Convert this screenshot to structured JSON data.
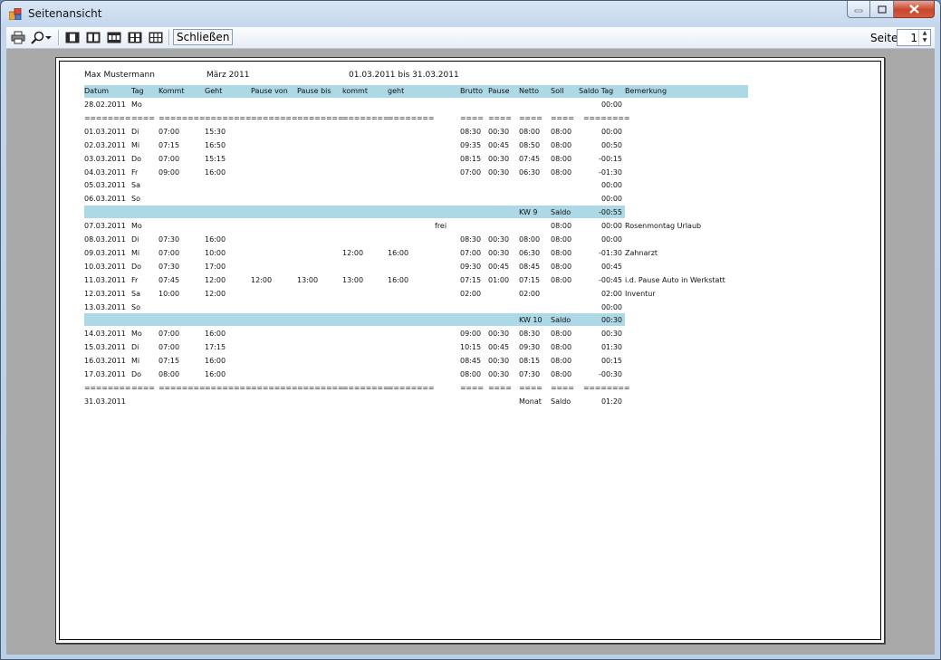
{
  "window": {
    "title": "Seitenansicht"
  },
  "toolbar": {
    "close_label": "Schließen",
    "page_label": "Seite",
    "page_value": "1"
  },
  "report": {
    "name": "Max Mustermann",
    "month": "März 2011",
    "period": "01.03.2011 bis 31.03.2011",
    "headers": [
      "Datum",
      "Tag",
      "Kommt",
      "Geht",
      "Pause von",
      "Pause bis",
      "kommt",
      "geht",
      "Brutto",
      "Pause",
      "Netto",
      "Soll",
      "Saldo Tag",
      "Bemerkung"
    ],
    "rows": [
      {
        "type": "day",
        "cells": [
          "28.02.2011",
          "Mo",
          "",
          "",
          "",
          "",
          "",
          "",
          "",
          "",
          "",
          "",
          "",
          "00:00",
          ""
        ]
      },
      {
        "type": "sep",
        "cells": [
          "========",
          "====",
          "========",
          "========",
          "========",
          "========",
          "========",
          "========",
          "",
          "====",
          "====",
          "====",
          "====",
          "========",
          ""
        ]
      },
      {
        "type": "day",
        "cells": [
          "01.03.2011",
          "Di",
          "07:00",
          "15:30",
          "",
          "",
          "",
          "",
          "",
          "08:30",
          "00:30",
          "08:00",
          "08:00",
          "00:00",
          ""
        ]
      },
      {
        "type": "day",
        "cells": [
          "02.03.2011",
          "Mi",
          "07:15",
          "16:50",
          "",
          "",
          "",
          "",
          "",
          "09:35",
          "00:45",
          "08:50",
          "08:00",
          "00:50",
          ""
        ]
      },
      {
        "type": "day",
        "cells": [
          "03.03.2011",
          "Do",
          "07:00",
          "15:15",
          "",
          "",
          "",
          "",
          "",
          "08:15",
          "00:30",
          "07:45",
          "08:00",
          "-00:15",
          ""
        ]
      },
      {
        "type": "day",
        "cells": [
          "04.03.2011",
          "Fr",
          "09:00",
          "16:00",
          "",
          "",
          "",
          "",
          "",
          "07:00",
          "00:30",
          "06:30",
          "08:00",
          "-01:30",
          ""
        ]
      },
      {
        "type": "day",
        "cells": [
          "05.03.2011",
          "Sa",
          "",
          "",
          "",
          "",
          "",
          "",
          "",
          "",
          "",
          "",
          "",
          "00:00",
          ""
        ]
      },
      {
        "type": "day",
        "cells": [
          "06.03.2011",
          "So",
          "",
          "",
          "",
          "",
          "",
          "",
          "",
          "",
          "",
          "",
          "",
          "00:00",
          ""
        ]
      },
      {
        "type": "kw",
        "cells": [
          "",
          "",
          "",
          "",
          "",
          "",
          "",
          "",
          "",
          "",
          "",
          "KW 9",
          "Saldo",
          "-00:55",
          ""
        ]
      },
      {
        "type": "day",
        "cells": [
          "07.03.2011",
          "Mo",
          "",
          "",
          "",
          "",
          "",
          "",
          "frei",
          "",
          "",
          "",
          "08:00",
          "00:00",
          "Rosenmontag Urlaub"
        ]
      },
      {
        "type": "day",
        "cells": [
          "08.03.2011",
          "Di",
          "07:30",
          "16:00",
          "",
          "",
          "",
          "",
          "",
          "08:30",
          "00:30",
          "08:00",
          "08:00",
          "00:00",
          ""
        ]
      },
      {
        "type": "day",
        "cells": [
          "09.03.2011",
          "Mi",
          "07:00",
          "10:00",
          "",
          "",
          "12:00",
          "16:00",
          "",
          "07:00",
          "00:30",
          "06:30",
          "08:00",
          "-01:30",
          "Zahnarzt"
        ]
      },
      {
        "type": "day",
        "cells": [
          "10.03.2011",
          "Do",
          "07:30",
          "17:00",
          "",
          "",
          "",
          "",
          "",
          "09:30",
          "00:45",
          "08:45",
          "08:00",
          "00:45",
          ""
        ]
      },
      {
        "type": "day",
        "cells": [
          "11.03.2011",
          "Fr",
          "07:45",
          "12:00",
          "12:00",
          "13:00",
          "13:00",
          "16:00",
          "",
          "07:15",
          "01:00",
          "07:15",
          "08:00",
          "-00:45",
          "i.d. Pause Auto in Werkstatt"
        ]
      },
      {
        "type": "day",
        "cells": [
          "12.03.2011",
          "Sa",
          "10:00",
          "12:00",
          "",
          "",
          "",
          "",
          "",
          "02:00",
          "",
          "02:00",
          "",
          "02:00",
          "Inventur"
        ]
      },
      {
        "type": "day",
        "cells": [
          "13.03.2011",
          "So",
          "",
          "",
          "",
          "",
          "",
          "",
          "",
          "",
          "",
          "",
          "",
          "00:00",
          ""
        ]
      },
      {
        "type": "kw",
        "cells": [
          "",
          "",
          "",
          "",
          "",
          "",
          "",
          "",
          "",
          "",
          "",
          "KW 10",
          "Saldo",
          "00:30",
          ""
        ]
      },
      {
        "type": "day",
        "cells": [
          "14.03.2011",
          "Mo",
          "07:00",
          "16:00",
          "",
          "",
          "",
          "",
          "",
          "09:00",
          "00:30",
          "08:30",
          "08:00",
          "00:30",
          ""
        ]
      },
      {
        "type": "day",
        "cells": [
          "15.03.2011",
          "Di",
          "07:00",
          "17:15",
          "",
          "",
          "",
          "",
          "",
          "10:15",
          "00:45",
          "09:30",
          "08:00",
          "01:30",
          ""
        ]
      },
      {
        "type": "day",
        "cells": [
          "16.03.2011",
          "Mi",
          "07:15",
          "16:00",
          "",
          "",
          "",
          "",
          "",
          "08:45",
          "00:30",
          "08:15",
          "08:00",
          "00:15",
          ""
        ]
      },
      {
        "type": "day",
        "cells": [
          "17.03.2011",
          "Do",
          "08:00",
          "16:00",
          "",
          "",
          "",
          "",
          "",
          "08:00",
          "00:30",
          "07:30",
          "08:00",
          "-00:30",
          ""
        ]
      },
      {
        "type": "sep",
        "cells": [
          "========",
          "====",
          "========",
          "========",
          "========",
          "========",
          "========",
          "========",
          "",
          "====",
          "====",
          "====",
          "====",
          "========",
          ""
        ]
      },
      {
        "type": "day",
        "cells": [
          "31.03.2011",
          "",
          "",
          "",
          "",
          "",
          "",
          "",
          "",
          "",
          "",
          "Monat",
          "Saldo",
          "01:20",
          ""
        ]
      }
    ]
  }
}
